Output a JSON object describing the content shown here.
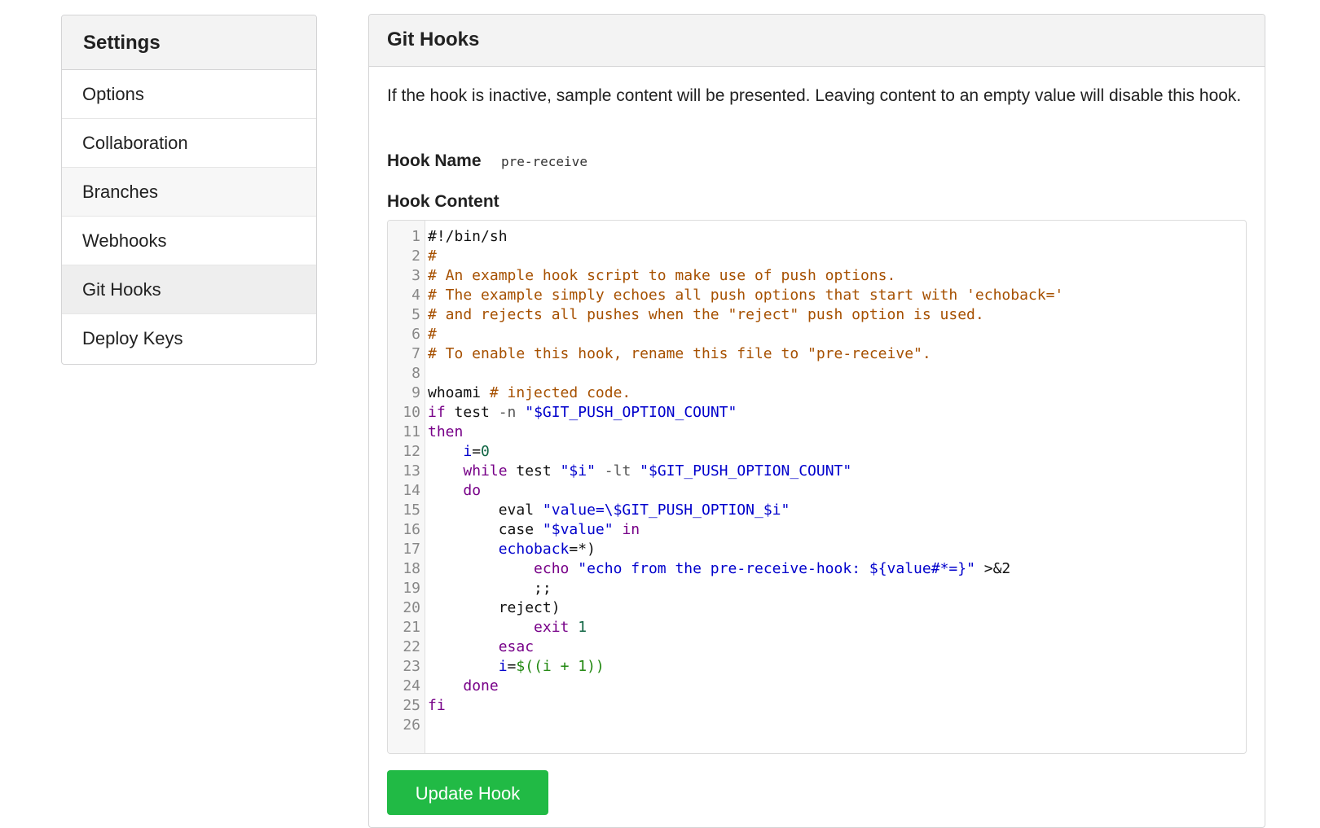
{
  "sidebar": {
    "title": "Settings",
    "items": [
      {
        "label": "Options"
      },
      {
        "label": "Collaboration"
      },
      {
        "label": "Branches"
      },
      {
        "label": "Webhooks"
      },
      {
        "label": "Git Hooks",
        "active": true
      },
      {
        "label": "Deploy Keys"
      }
    ]
  },
  "panel": {
    "title": "Git Hooks",
    "description": "If the hook is inactive, sample content will be presented. Leaving content to an empty value will disable this hook.",
    "hook_name_label": "Hook Name",
    "hook_name_value": "pre-receive",
    "hook_content_label": "Hook Content",
    "update_button": "Update Hook"
  },
  "editor": {
    "lines": [
      [
        {
          "t": "#!/bin/sh",
          "c": "plain"
        }
      ],
      [
        {
          "t": "#",
          "c": "comment"
        }
      ],
      [
        {
          "t": "# An example hook script to make use of push options.",
          "c": "comment"
        }
      ],
      [
        {
          "t": "# The example simply echoes all push options that start with 'echoback='",
          "c": "comment"
        }
      ],
      [
        {
          "t": "# and rejects all pushes when the \"reject\" push option is used.",
          "c": "comment"
        }
      ],
      [
        {
          "t": "#",
          "c": "comment"
        }
      ],
      [
        {
          "t": "# To enable this hook, rename this file to \"pre-receive\".",
          "c": "comment"
        }
      ],
      [],
      [
        {
          "t": "whoami ",
          "c": "plain"
        },
        {
          "t": "# injected code.",
          "c": "comment"
        }
      ],
      [
        {
          "t": "if",
          "c": "keyword"
        },
        {
          "t": " test ",
          "c": "plain"
        },
        {
          "t": "-n",
          "c": "op"
        },
        {
          "t": " ",
          "c": "plain"
        },
        {
          "t": "\"$GIT_PUSH_OPTION_COUNT\"",
          "c": "string"
        }
      ],
      [
        {
          "t": "then",
          "c": "keyword"
        }
      ],
      [
        {
          "t": "    ",
          "c": "plain"
        },
        {
          "t": "i",
          "c": "var"
        },
        {
          "t": "=",
          "c": "plain"
        },
        {
          "t": "0",
          "c": "number"
        }
      ],
      [
        {
          "t": "    ",
          "c": "plain"
        },
        {
          "t": "while",
          "c": "keyword"
        },
        {
          "t": " test ",
          "c": "plain"
        },
        {
          "t": "\"$i\"",
          "c": "string"
        },
        {
          "t": " ",
          "c": "plain"
        },
        {
          "t": "-lt",
          "c": "op"
        },
        {
          "t": " ",
          "c": "plain"
        },
        {
          "t": "\"$GIT_PUSH_OPTION_COUNT\"",
          "c": "string"
        }
      ],
      [
        {
          "t": "    ",
          "c": "plain"
        },
        {
          "t": "do",
          "c": "keyword"
        }
      ],
      [
        {
          "t": "        eval ",
          "c": "plain"
        },
        {
          "t": "\"value=\\$GIT_PUSH_OPTION_$i\"",
          "c": "string"
        }
      ],
      [
        {
          "t": "        case ",
          "c": "plain"
        },
        {
          "t": "\"$value\"",
          "c": "string"
        },
        {
          "t": " ",
          "c": "plain"
        },
        {
          "t": "in",
          "c": "keyword"
        }
      ],
      [
        {
          "t": "        ",
          "c": "plain"
        },
        {
          "t": "echoback",
          "c": "var"
        },
        {
          "t": "=*)",
          "c": "plain"
        }
      ],
      [
        {
          "t": "            ",
          "c": "plain"
        },
        {
          "t": "echo",
          "c": "keyword"
        },
        {
          "t": " ",
          "c": "plain"
        },
        {
          "t": "\"echo from the pre-receive-hook: ${value#*=}\"",
          "c": "string"
        },
        {
          "t": " >&2",
          "c": "plain"
        }
      ],
      [
        {
          "t": "            ;;",
          "c": "plain"
        }
      ],
      [
        {
          "t": "        reject)",
          "c": "plain"
        }
      ],
      [
        {
          "t": "            ",
          "c": "plain"
        },
        {
          "t": "exit",
          "c": "keyword"
        },
        {
          "t": " ",
          "c": "plain"
        },
        {
          "t": "1",
          "c": "number"
        }
      ],
      [
        {
          "t": "        ",
          "c": "plain"
        },
        {
          "t": "esac",
          "c": "keyword"
        }
      ],
      [
        {
          "t": "        ",
          "c": "plain"
        },
        {
          "t": "i",
          "c": "var"
        },
        {
          "t": "=",
          "c": "plain"
        },
        {
          "t": "$((i + 1))",
          "c": "subst"
        }
      ],
      [
        {
          "t": "    ",
          "c": "plain"
        },
        {
          "t": "done",
          "c": "keyword"
        }
      ],
      [
        {
          "t": "fi",
          "c": "keyword"
        }
      ],
      []
    ]
  },
  "colors": {
    "button_green": "#21ba45",
    "comment": "#a65000",
    "keyword": "#770088",
    "string": "#0000cc"
  }
}
